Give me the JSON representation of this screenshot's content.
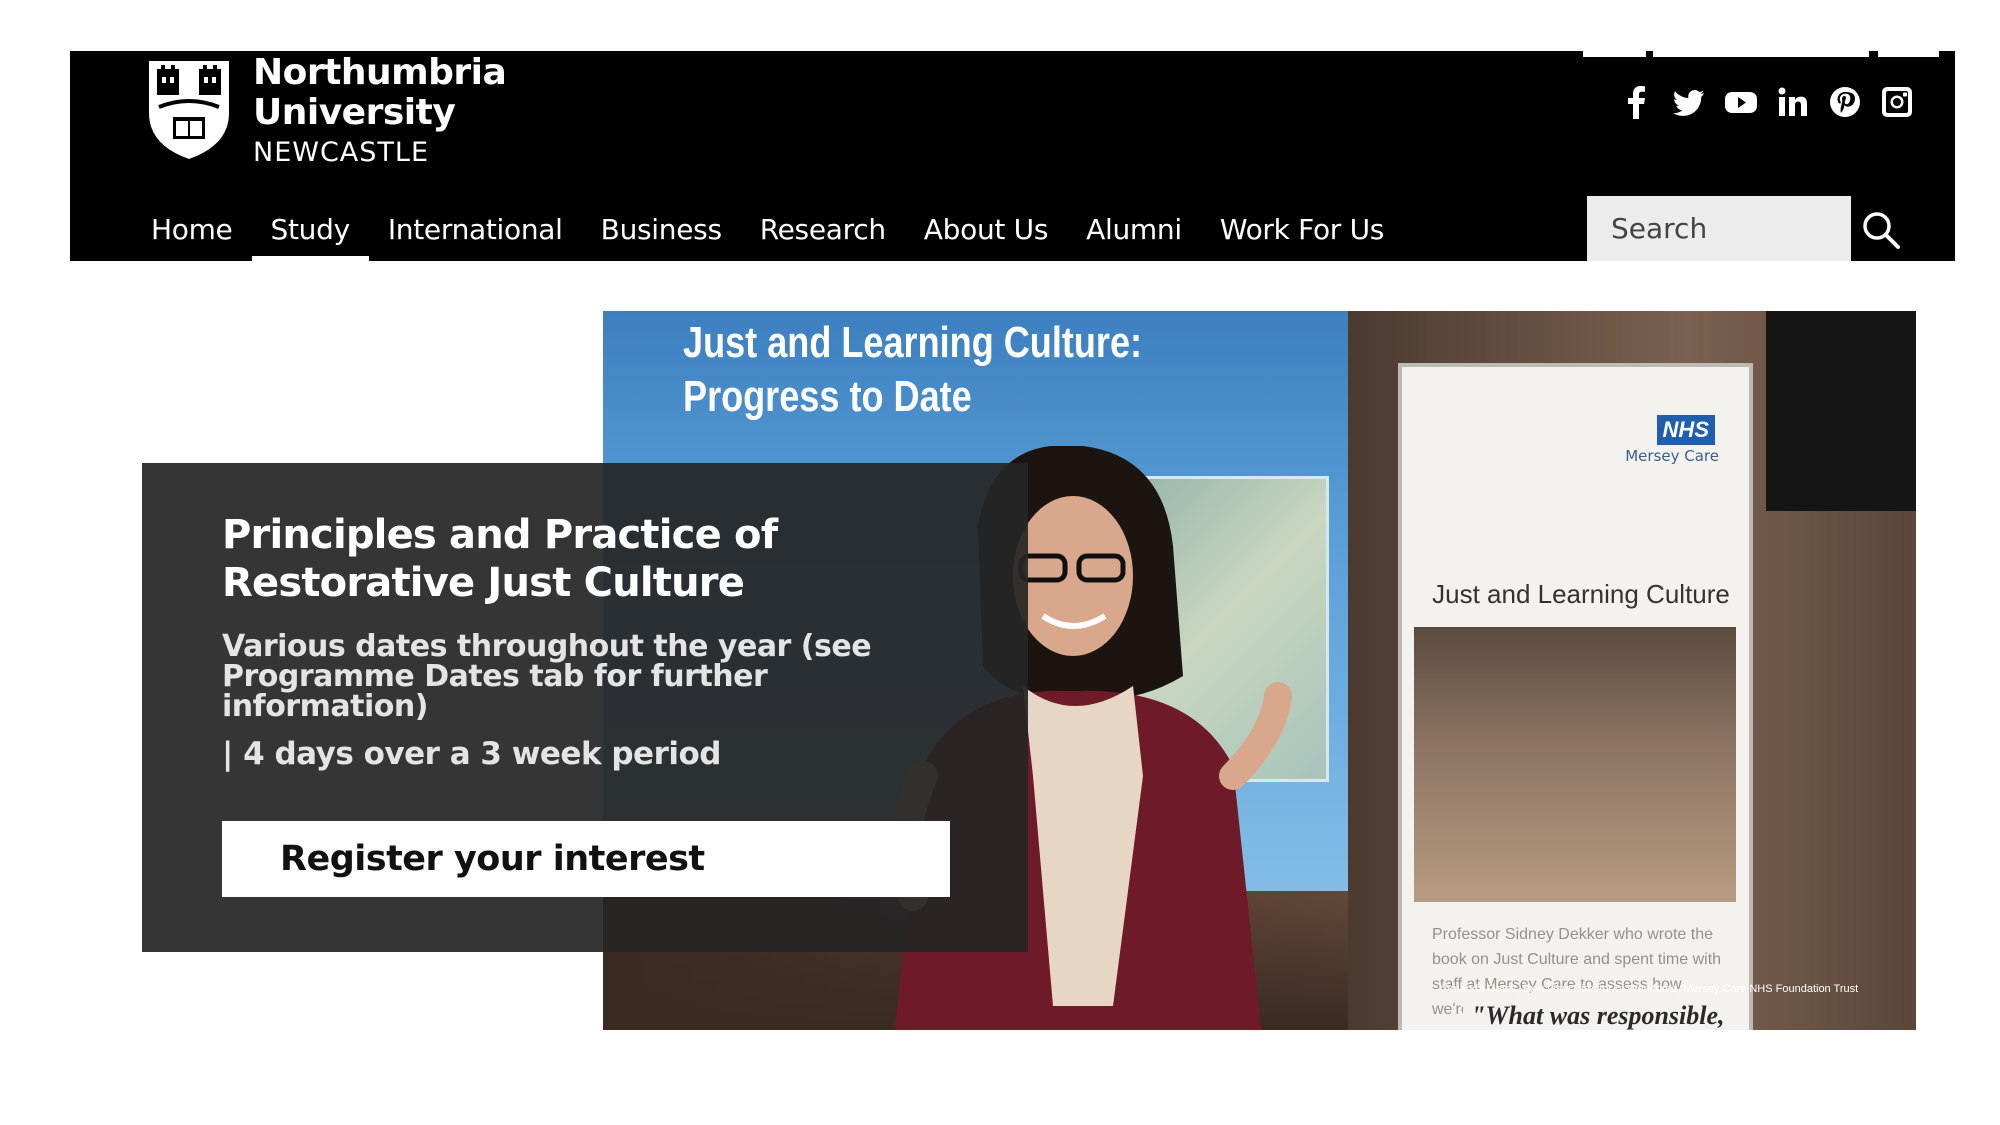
{
  "logo": {
    "line1": "Northumbria",
    "line2": "University",
    "line3": "NEWCASTLE"
  },
  "social": [
    "facebook-icon",
    "twitter-icon",
    "youtube-icon",
    "linkedin-icon",
    "pinterest-icon",
    "instagram-icon"
  ],
  "nav": {
    "items": [
      {
        "label": "Home"
      },
      {
        "label": "Study"
      },
      {
        "label": "International"
      },
      {
        "label": "Business"
      },
      {
        "label": "Research"
      },
      {
        "label": "About Us"
      },
      {
        "label": "Alumni"
      },
      {
        "label": "Work For Us"
      }
    ],
    "active": "Study"
  },
  "search": {
    "placeholder": "Search"
  },
  "hero": {
    "title": "Principles and Practice of Restorative Just Culture",
    "dates": "Various dates throughout the year (see Programme Dates tab for further information)",
    "duration": "| 4 days over a 3 week period",
    "cta_label": "Register your interest",
    "photo": {
      "slide_title_line1": "Just and Learning Culture:",
      "slide_title_line2": "Progress to Date",
      "banner_org_logo": "NHS",
      "banner_org_name": "Mersey Care",
      "banner_heading": "Just and Learning Culture",
      "banner_quote": "Professor Sidney Dekker who wrote the book on Just Culture and spent time with staff at Mersey Care to assess how we're doing, asks:",
      "banner_credit": "*Amanda Oates, Executive Director of Workforce, Mersey Care NHS Foundation Trust",
      "banner_pullquote": "\"What was responsible,"
    }
  },
  "colors": {
    "header_bg": "#000000",
    "panel_bg": "#262626",
    "cta_bg": "#ffffff",
    "search_bg": "#ececec"
  }
}
